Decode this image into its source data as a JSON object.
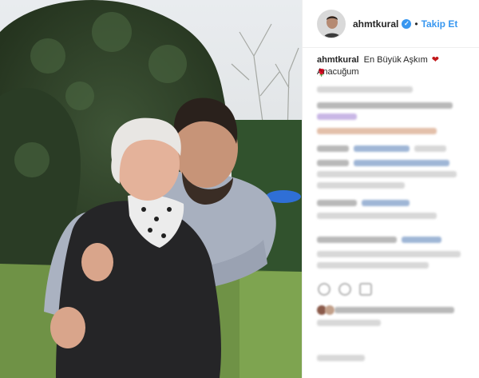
{
  "post": {
    "username": "ahmtkural",
    "follow_label": "Takip Et",
    "separator": "•",
    "caption_text": "En Büyük Aşkım",
    "caption_suffix": "Anacuğum",
    "heart": "❤",
    "rose": "🌹"
  },
  "icons": {
    "verified": "verified-badge-icon",
    "like": "heart-icon",
    "comment": "comment-icon",
    "share": "share-icon"
  },
  "colors": {
    "accent": "#3897f0",
    "heart": "#c2181b",
    "text": "#262626",
    "border": "#efefef"
  }
}
